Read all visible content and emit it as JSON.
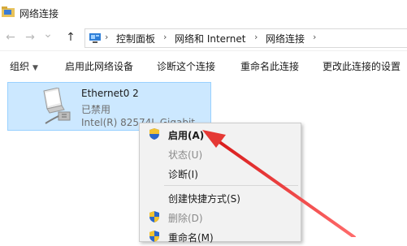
{
  "window": {
    "title": "网络连接"
  },
  "address": {
    "back_glyph": "←",
    "forward_glyph": "→",
    "dropdown_glyph": "⌄",
    "up_glyph": "↑",
    "crumbs": [
      "控制面板",
      "网络和 Internet",
      "网络连接"
    ],
    "separator": "›"
  },
  "toolbar": {
    "organize": "组织",
    "organize_caret": "▼",
    "disable": "启用此网络设备",
    "diagnose": "诊断这个连接",
    "rename": "重命名此连接",
    "change_settings": "更改此连接的设置"
  },
  "adapter": {
    "name": "Ethernet0 2",
    "status": "已禁用",
    "device": "Intel(R) 82574L Gigabit..."
  },
  "context_menu": {
    "items": [
      {
        "label": "启用(A)",
        "icon": "shield-icon"
      },
      {
        "label": "状态(U)"
      },
      {
        "label": "诊断(I)"
      },
      {
        "label": "创建快捷方式(S)"
      },
      {
        "label": "删除(D)",
        "icon": "shield-icon"
      },
      {
        "label": "重命名(M)",
        "icon": "shield-icon"
      }
    ]
  },
  "colors": {
    "selection": "#cce8ff",
    "selection_border": "#99d1ff",
    "arrow": "#e53935",
    "menu_bg": "#f2f2f2"
  }
}
